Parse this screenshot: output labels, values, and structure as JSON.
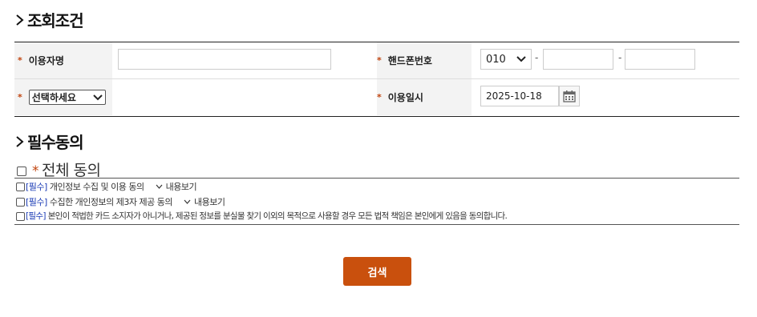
{
  "search_section": {
    "title": "조회조건"
  },
  "form": {
    "required_mark": "*",
    "user_name": {
      "label": "이용자명",
      "value": ""
    },
    "phone": {
      "label": "핸드폰번호",
      "prefix": "010",
      "separator": "-",
      "middle": "",
      "last": ""
    },
    "select": {
      "value": "선택하세요"
    },
    "use_date": {
      "label": "이용일시",
      "value": "2025-10-18"
    }
  },
  "consent_section": {
    "title": "필수동의",
    "all_label": "전체 동의",
    "items": [
      {
        "tag": "[필수]",
        "text": "개인정보 수집 및 이용 동의",
        "view_label": "내용보기"
      },
      {
        "tag": "[필수]",
        "text": "수집한 개인정보의 제3자 제공 동의",
        "view_label": "내용보기"
      },
      {
        "tag": "[필수]",
        "text": "본인이 적법한 카드 소지자가 아니거나, 제공된 정보를 분실물 찾기 이외의 목적으로 사용할 경우 모든 법적 책임은 본인에게 있음을 동의합니다."
      }
    ]
  },
  "search_button": {
    "label": "검색"
  }
}
